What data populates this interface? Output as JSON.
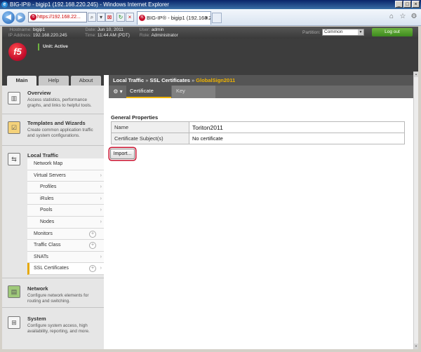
{
  "browser": {
    "window_title": "BIG-IP® - bigip1 (192.168.220.245) - Windows Internet Explorer",
    "address": "https://192.168.22...",
    "tab_title": "BIG-IP® - bigip1 (192.168.2...",
    "icons": [
      "ie-logo-icon",
      "back-arrow-icon",
      "forward-arrow-icon",
      "cert-error-icon",
      "refresh-icon",
      "stop-icon",
      "home-icon",
      "favorites-star-icon",
      "tools-gear-icon"
    ]
  },
  "header": {
    "hostname_label": "Hostname:",
    "hostname": "bigip1",
    "ip_label": "IP Address:",
    "ip": "192.168.220.245",
    "date_label": "Date:",
    "date": "Jun 10, 2011",
    "time_label": "Time:",
    "time": "11:44 AM (PDT)",
    "user_label": "User:",
    "user": "admin",
    "role_label": "Role:",
    "role": "Administrator",
    "partition_label": "Partition:",
    "partition_value": "Common",
    "logout_label": "Log out",
    "logo_text": "f5",
    "unit_status": "Unit: Active"
  },
  "sidebar": {
    "tabs": [
      "Main",
      "Help",
      "About"
    ],
    "overview": {
      "title": "Overview",
      "desc": "Access statistics, performance graphs, and links to helpful tools."
    },
    "templates": {
      "title": "Templates and Wizards",
      "desc": "Create common application traffic and system configurations."
    },
    "local_traffic": {
      "title": "Local Traffic",
      "items": [
        {
          "label": "Network Map"
        },
        {
          "label": "Virtual Servers"
        },
        {
          "label": "Profiles"
        },
        {
          "label": "iRules"
        },
        {
          "label": "Pools"
        },
        {
          "label": "Nodes"
        },
        {
          "label": "Monitors"
        },
        {
          "label": "Traffic Class"
        },
        {
          "label": "SNATs"
        },
        {
          "label": "SSL Certificates"
        }
      ]
    },
    "network": {
      "title": "Network",
      "desc": "Configure network elements for routing and switching."
    },
    "system": {
      "title": "System",
      "desc": "Configure system access, high availability, reporting, and more."
    }
  },
  "main": {
    "breadcrumb": {
      "part1": "Local Traffic",
      "sep": "»",
      "part2": "SSL Certificates",
      "current": "GlobalSign2011"
    },
    "subtabs": [
      "Certificate",
      "Key"
    ],
    "section_title": "General Properties",
    "properties": [
      {
        "label": "Name",
        "value": "Toriton2011"
      },
      {
        "label": "Certificate Subject(s)",
        "value": "No certificate"
      }
    ],
    "import_label": "Import..."
  },
  "colors": {
    "accent": "#f0b400",
    "brand_red": "#c8102e",
    "logout_green": "#4c9a2a",
    "header_dark": "#3d3d3d"
  }
}
